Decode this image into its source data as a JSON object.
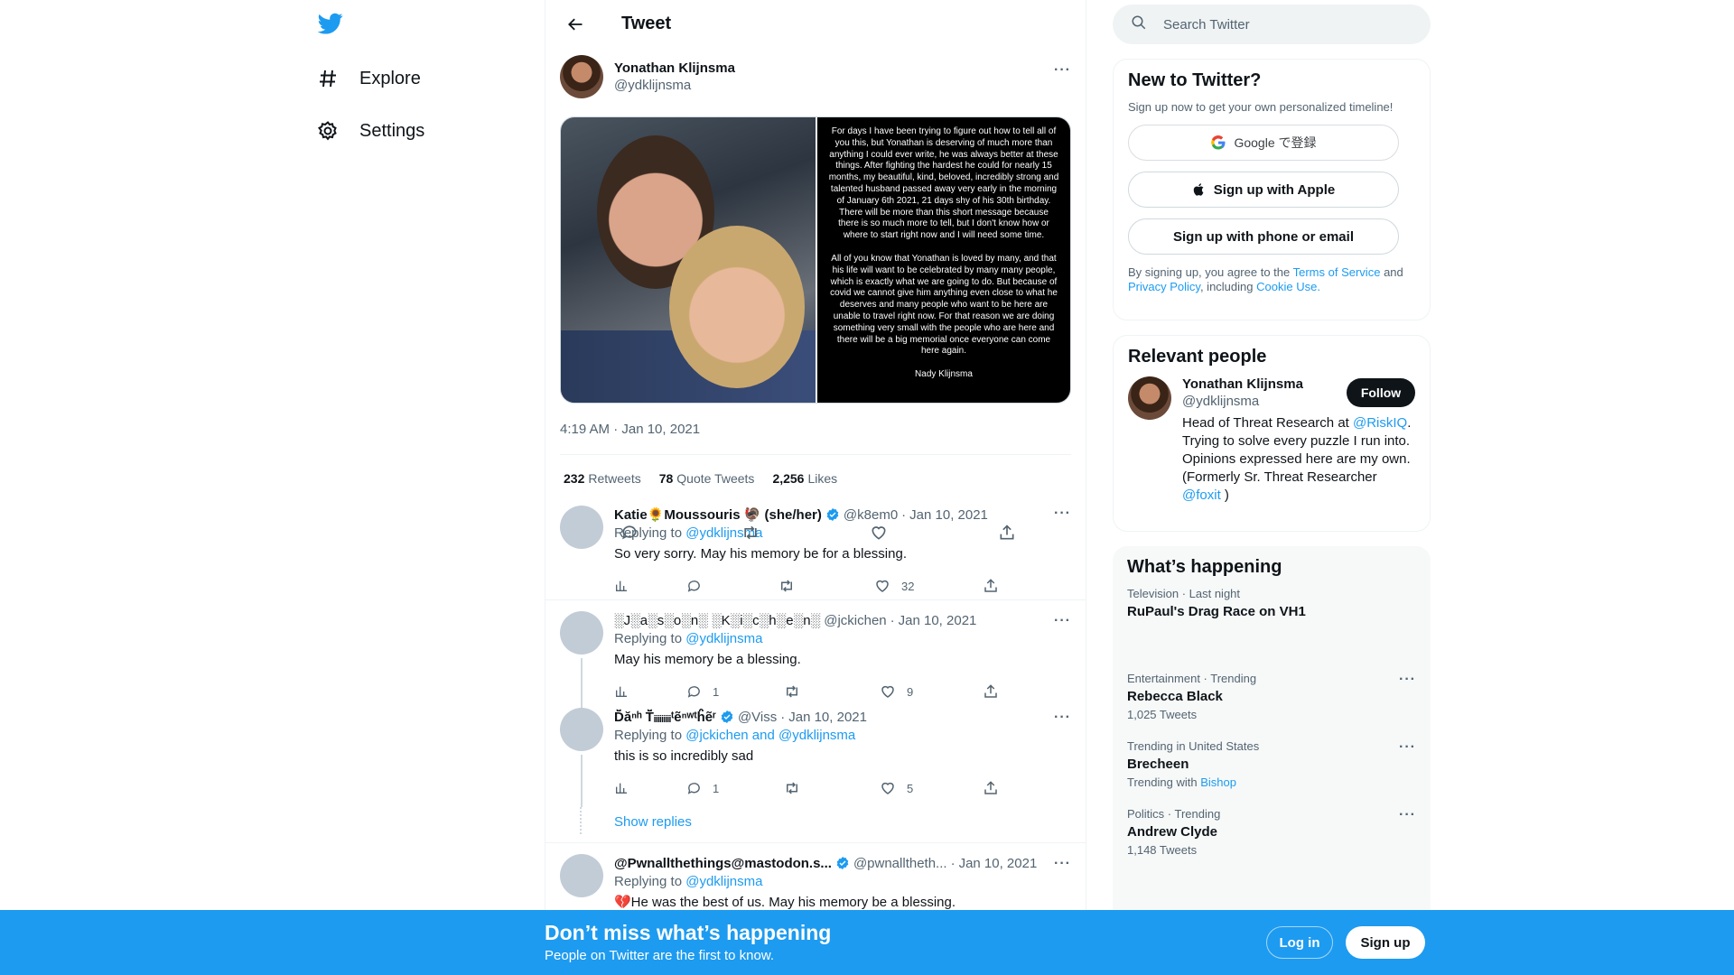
{
  "nav": {
    "items": [
      {
        "label": "Explore",
        "icon": "hashtag-icon"
      },
      {
        "label": "Settings",
        "icon": "gear-icon"
      }
    ]
  },
  "header": {
    "title": "Tweet"
  },
  "main_tweet": {
    "author_name": "Yonathan Klijnsma",
    "author_handle": "@ydklijnsma",
    "image_text_p1": "For days I have been trying to figure out how to tell all of you this, but Yonathan is deserving of much more than anything I could ever write, he was always better at these things. After fighting the hardest he could for nearly 15 months, my beautiful, kind, beloved, incredibly strong and talented husband passed away very early in the morning of January 6th 2021, 21 days shy of his 30th birthday. There will be more than this short message because there is so much more to tell, but I don't know how or where to start right now and I will need some time.",
    "image_text_p2": "All of you know that Yonathan is loved by many, and that his life will want to be celebrated by many many people, which is exactly what we are going to do. But because of covid we cannot give him anything even close to what he deserves and many people who want to be here are unable to travel right now. For that reason we are doing something very small with the people who are here and there will be a big memorial once everyone can come here again.",
    "image_signature": "Nady Klijnsma",
    "timestamp": "4:19 AM · Jan 10, 2021",
    "retweets_count": "232",
    "retweets_label": "Retweets",
    "quotes_count": "78",
    "quotes_label": "Quote Tweets",
    "likes_count": "2,256",
    "likes_label": "Likes"
  },
  "replies": [
    {
      "name": "Katie🌻Moussouris 🦃 (she/her)",
      "handle": "@k8em0",
      "date": "Jan 10, 2021",
      "replying_prefix": "Replying to",
      "replying_to": "@ydklijnsma",
      "text": "So very sorry. May his memory be for a blessing.",
      "replies": "",
      "retweets": "",
      "likes": "32"
    },
    {
      "name": "░J░a░s░o░n░ ░K░i░c░h░e░n░",
      "handle": "@jckichen",
      "date": "Jan 10, 2021",
      "replying_prefix": "Replying to",
      "replying_to": "@ydklijnsma",
      "text": "May his memory be a blessing.",
      "replies": "1",
      "retweets": "",
      "likes": "9"
    },
    {
      "name": "Ď̈ăⁿʰ Ť̈ᵢᵢᵢᵢᵢᵢᵢᵢᵢᵗẽⁿʷᵗĥ̈ẽʳ",
      "handle": "@Viss",
      "date": "Jan 10, 2021",
      "replying_prefix": "Replying to",
      "replying_to": "@jckichen and @ydklijnsma",
      "text": "this is so incredibly sad",
      "replies": "1",
      "retweets": "",
      "likes": "5"
    },
    {
      "name": "@Pwnallthethings@mastodon.s...",
      "handle": "@pwnalltheth...",
      "date": "Jan 10, 2021",
      "replying_prefix": "Replying to",
      "replying_to": "@ydklijnsma",
      "text": "💔He was the best of us. May his memory be a blessing."
    }
  ],
  "show_replies": "Show replies",
  "search": {
    "placeholder": "Search Twitter"
  },
  "signup_card": {
    "title": "New to Twitter?",
    "subtitle": "Sign up now to get your own personalized timeline!",
    "google_label": "Google で登録",
    "apple_label": "Sign up with Apple",
    "phone_label": "Sign up with phone or email",
    "legal_prefix": "By signing up, you agree to the",
    "terms": "Terms of Service",
    "and": "and",
    "privacy": "Privacy Policy",
    "including": ", including",
    "cookie": "Cookie Use."
  },
  "relevant_people": {
    "title": "Relevant people",
    "name": "Yonathan Klijnsma",
    "handle": "@ydklijnsma",
    "follow_label": "Follow",
    "bio_1": "Head of Threat Research at",
    "bio_link1": "@RiskIQ",
    "bio_2": ". Trying to solve every puzzle I run into. Opinions expressed here are my own. (Formerly Sr. Threat Researcher",
    "bio_link2": "@foxit",
    "bio_3": ")"
  },
  "happening": {
    "title": "What’s happening",
    "trends": [
      {
        "meta": "Television · Last night",
        "name": "RuPaul's Drag Race on VH1",
        "count": ""
      },
      {
        "meta": "Entertainment · Trending",
        "name": "Rebecca Black",
        "count": "1,025 Tweets"
      },
      {
        "meta": "Trending in United States",
        "name": "Brecheen",
        "count_prefix": "Trending with",
        "count_link": "Bishop"
      },
      {
        "meta": "Politics · Trending",
        "name": "Andrew Clyde",
        "count": "1,148 Tweets"
      }
    ]
  },
  "bottom_bar": {
    "title": "Don’t miss what’s happening",
    "subtitle": "People on Twitter are the first to know.",
    "login": "Log in",
    "signup": "Sign up"
  },
  "colors": {
    "accent": "#1d9bf0",
    "text": "#0f1419",
    "muted": "#536471"
  }
}
